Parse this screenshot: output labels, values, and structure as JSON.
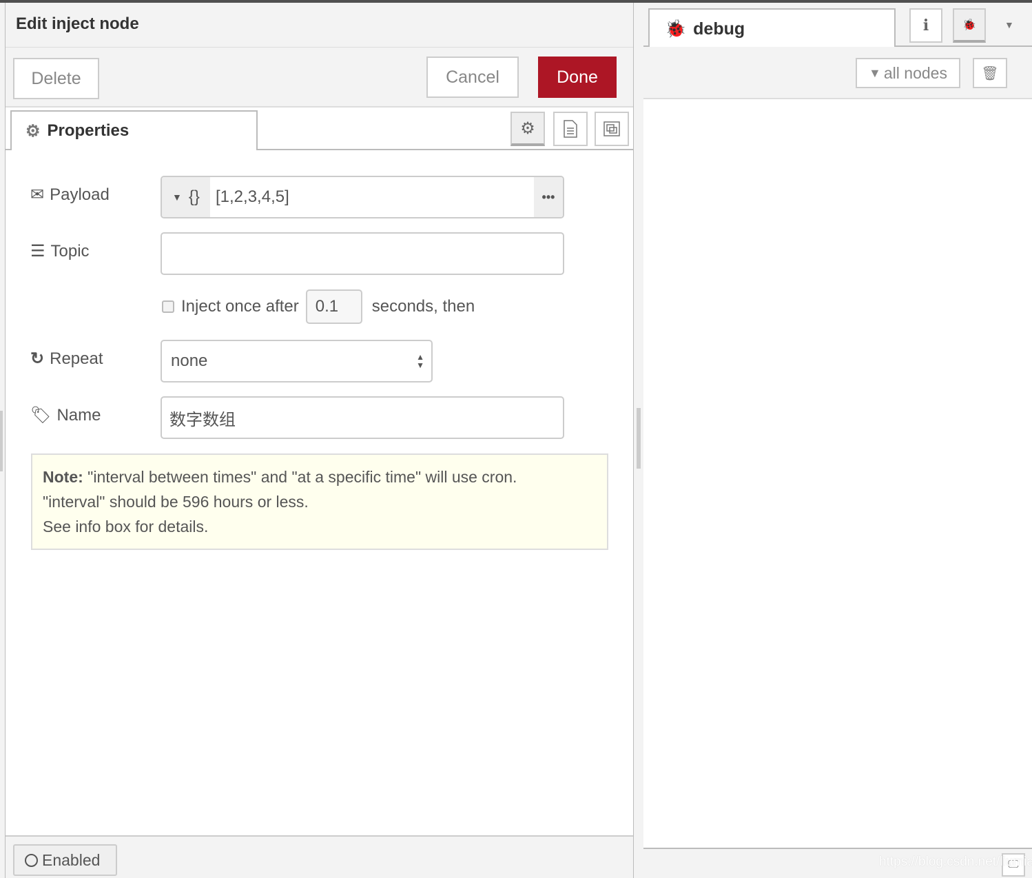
{
  "editor": {
    "title": "Edit inject node",
    "delete_label": "Delete",
    "cancel_label": "Cancel",
    "done_label": "Done",
    "tab_properties": "Properties",
    "payload": {
      "label": "Payload",
      "type_icon": "{}",
      "value": "[1,2,3,4,5]"
    },
    "topic": {
      "label": "Topic",
      "value": ""
    },
    "inject_once": {
      "label": "Inject once after",
      "checked": false,
      "delay": "0.1",
      "suffix": "seconds, then"
    },
    "repeat": {
      "label": "Repeat",
      "value": "none"
    },
    "name": {
      "label": "Name",
      "value": "数字数组"
    },
    "note": {
      "bold": "Note:",
      "line1": " \"interval between times\" and \"at a specific time\" will use cron.",
      "line2": "\"interval\" should be 596 hours or less.",
      "line3": "See info box for details."
    },
    "enabled_label": "Enabled"
  },
  "sidebar": {
    "tab_label": "debug",
    "filter_label": "all nodes"
  },
  "watermark": "https://blog.csdn.net/liumiaocn",
  "colors": {
    "accent": "#ad1625",
    "note_bg": "#ffffee"
  }
}
